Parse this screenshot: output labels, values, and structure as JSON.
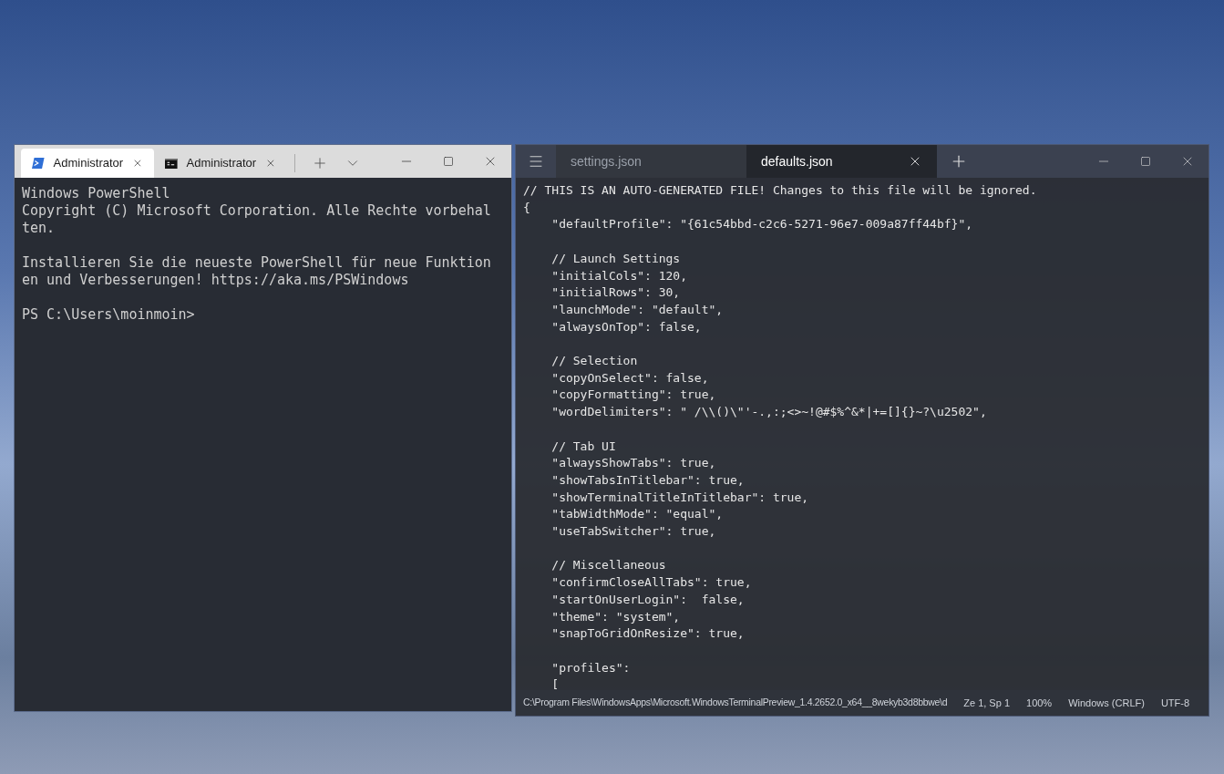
{
  "terminal": {
    "tabs": [
      {
        "kind": "powershell",
        "label": "Administrator",
        "selected": true
      },
      {
        "kind": "cmd",
        "label": "Administrator",
        "selected": false
      }
    ],
    "output": [
      [
        "Windows PowerShell",
        "Copyright (C) Microsoft Corporation. Alle Rechte vorbehal",
        "ten."
      ],
      [
        "Installieren Sie die neueste PowerShell für neue Funktion",
        "en und Verbesserungen! https://aka.ms/PSWindows"
      ],
      [
        "PS C:\\Users\\moinmoin>"
      ]
    ]
  },
  "editor": {
    "tabs": [
      {
        "label": "settings.json",
        "selected": false
      },
      {
        "label": "defaults.json",
        "selected": true
      }
    ],
    "code": [
      [
        "// THIS IS AN AUTO-GENERATED FILE! Changes to this file will be ignored.",
        "{",
        "    \"defaultProfile\": \"{61c54bbd-c2c6-5271-96e7-009a87ff44bf}\","
      ],
      [
        "    // Launch Settings",
        "    \"initialCols\": 120,",
        "    \"initialRows\": 30,",
        "    \"launchMode\": \"default\",",
        "    \"alwaysOnTop\": false,"
      ],
      [
        "    // Selection",
        "    \"copyOnSelect\": false,",
        "    \"copyFormatting\": true,",
        "    \"wordDelimiters\": \" /\\\\()\\\"'-.,:;<>~!@#$%^&*|+=[]{}~?\\u2502\","
      ],
      [
        "    // Tab UI",
        "    \"alwaysShowTabs\": true,",
        "    \"showTabsInTitlebar\": true,",
        "    \"showTerminalTitleInTitlebar\": true,",
        "    \"tabWidthMode\": \"equal\",",
        "    \"useTabSwitcher\": true,"
      ],
      [
        "    // Miscellaneous",
        "    \"confirmCloseAllTabs\": true,",
        "    \"startOnUserLogin\":  false,",
        "    \"theme\": \"system\",",
        "    \"snapToGridOnResize\": true,"
      ],
      [
        "    \"profiles\":",
        "    ["
      ]
    ],
    "status_bar": [
      "C:\\Program Files\\WindowsApps\\Microsoft.WindowsTerminalPreview_1.4.2652.0_x64__8wekyb3d8bbwe\\d",
      "Ze 1, Sp 1",
      "100%",
      "Windows (CRLF)",
      "UTF-8"
    ]
  }
}
